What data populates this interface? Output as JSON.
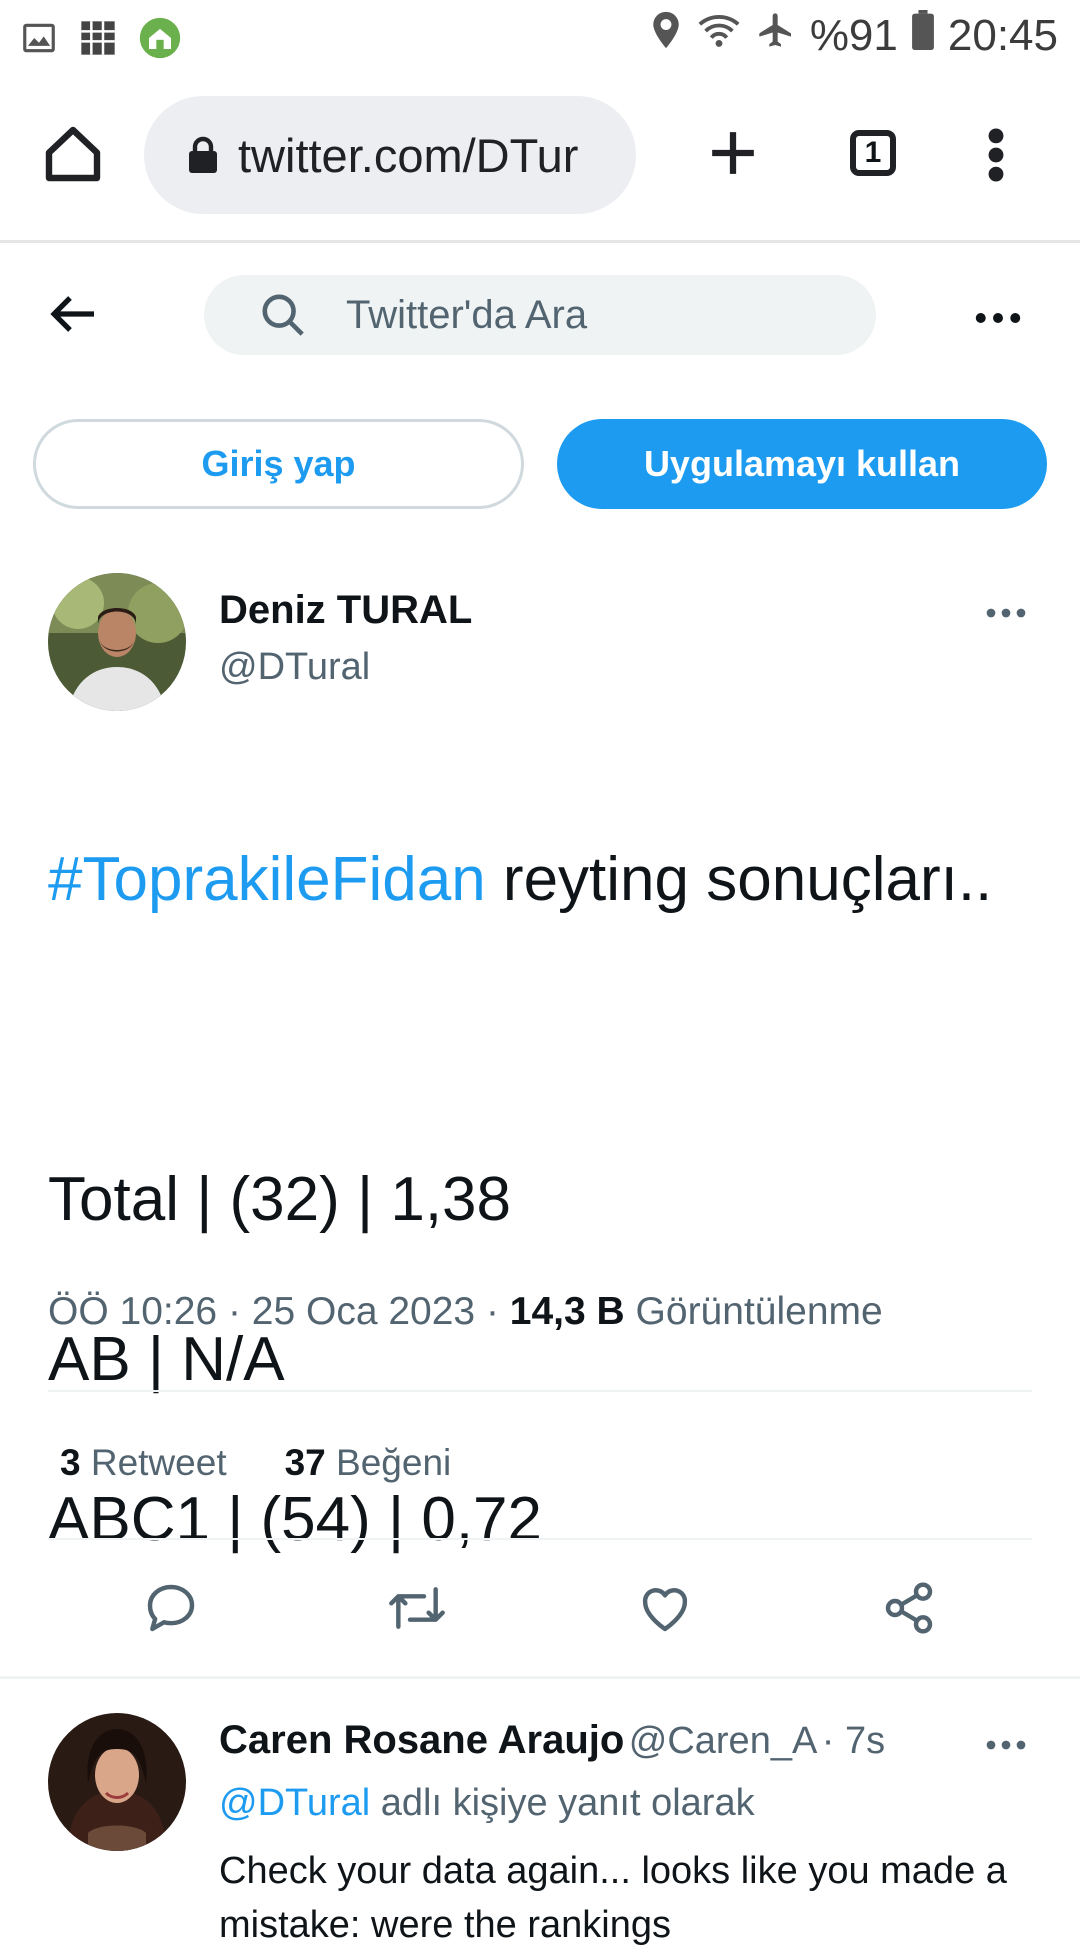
{
  "status_bar": {
    "battery": "%91",
    "time": "20:45"
  },
  "browser": {
    "url": "twitter.com/DTur",
    "tab_count": "1"
  },
  "header": {
    "search_placeholder": "Twitter'da Ara"
  },
  "auth": {
    "login_label": "Giriş yap",
    "use_app_label": "Uygulamayı kullan"
  },
  "tweet": {
    "author_name": "Deniz TURAL",
    "author_handle": "@DTural",
    "hashtag": "#ToprakileFidan",
    "text_after_hashtag": " reyting sonuçları..",
    "lines": [
      "Total | (32) | 1,38",
      "AB | N/A",
      "ABC1 | (54) | 0,72"
    ],
    "time": "ÖÖ 10:26",
    "date": "25 Oca 2023",
    "views_count": "14,3 B",
    "views_label": "Görüntülenme",
    "retweet_count": "3",
    "retweet_label": "Retweet",
    "like_count": "37",
    "like_label": "Beğeni"
  },
  "reply": {
    "author_name": "Caren Rosane Araujo",
    "author_handle": "@Caren_A",
    "time": "7s",
    "reply_to_handle": "@DTural",
    "reply_to_suffix": " adlı kişiye yanıt olarak",
    "text": "Check your data again... looks like you made a mistake: were the rankings"
  },
  "colors": {
    "accent": "#1d9bf0",
    "text_primary": "#0f1419",
    "text_secondary": "#536471"
  }
}
